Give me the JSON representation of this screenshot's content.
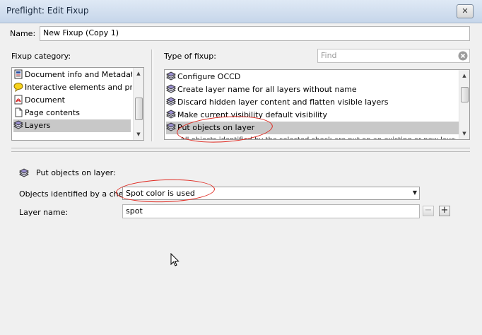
{
  "window": {
    "title": "Preflight: Edit Fixup",
    "close_glyph": "✕"
  },
  "name_field": {
    "label": "Name:",
    "value": "New Fixup (Copy 1)"
  },
  "fixup_category": {
    "label": "Fixup category:",
    "items": [
      {
        "label": "Document info and Metadata",
        "icon": "document-info-icon"
      },
      {
        "label": "Interactive elements and properties",
        "icon": "speech-bubble-icon"
      },
      {
        "label": "Document",
        "icon": "pdf-document-icon"
      },
      {
        "label": "Page contents",
        "icon": "page-icon"
      },
      {
        "label": "Layers",
        "icon": "layers-icon",
        "selected": true
      }
    ]
  },
  "type_of_fixup": {
    "label": "Type of fixup:",
    "search_placeholder": "Find",
    "items": [
      {
        "label": "Configure OCCD",
        "icon": "layers-icon"
      },
      {
        "label": "Create layer name for all layers without name",
        "icon": "layers-icon"
      },
      {
        "label": "Discard hidden layer content and flatten visible layers",
        "icon": "layers-icon"
      },
      {
        "label": "Make current visibility default visibility",
        "icon": "layers-icon"
      },
      {
        "label": "Put objects on layer",
        "icon": "layers-icon",
        "selected": true
      }
    ],
    "description_partial": "All objects identified by the selected check are put on an existing or new layer"
  },
  "detail": {
    "header_label": "Put objects on layer:",
    "check_label": "Objects identified by a check:",
    "check_value": "Spot color is used",
    "layer_label": "Layer name:",
    "layer_value": "spot",
    "minus_glyph": "−",
    "plus_glyph": "+"
  },
  "colors": {
    "annotation_red": "#e0281f",
    "selection_gray": "#c8c8c8",
    "title_text": "#1b2b40"
  }
}
